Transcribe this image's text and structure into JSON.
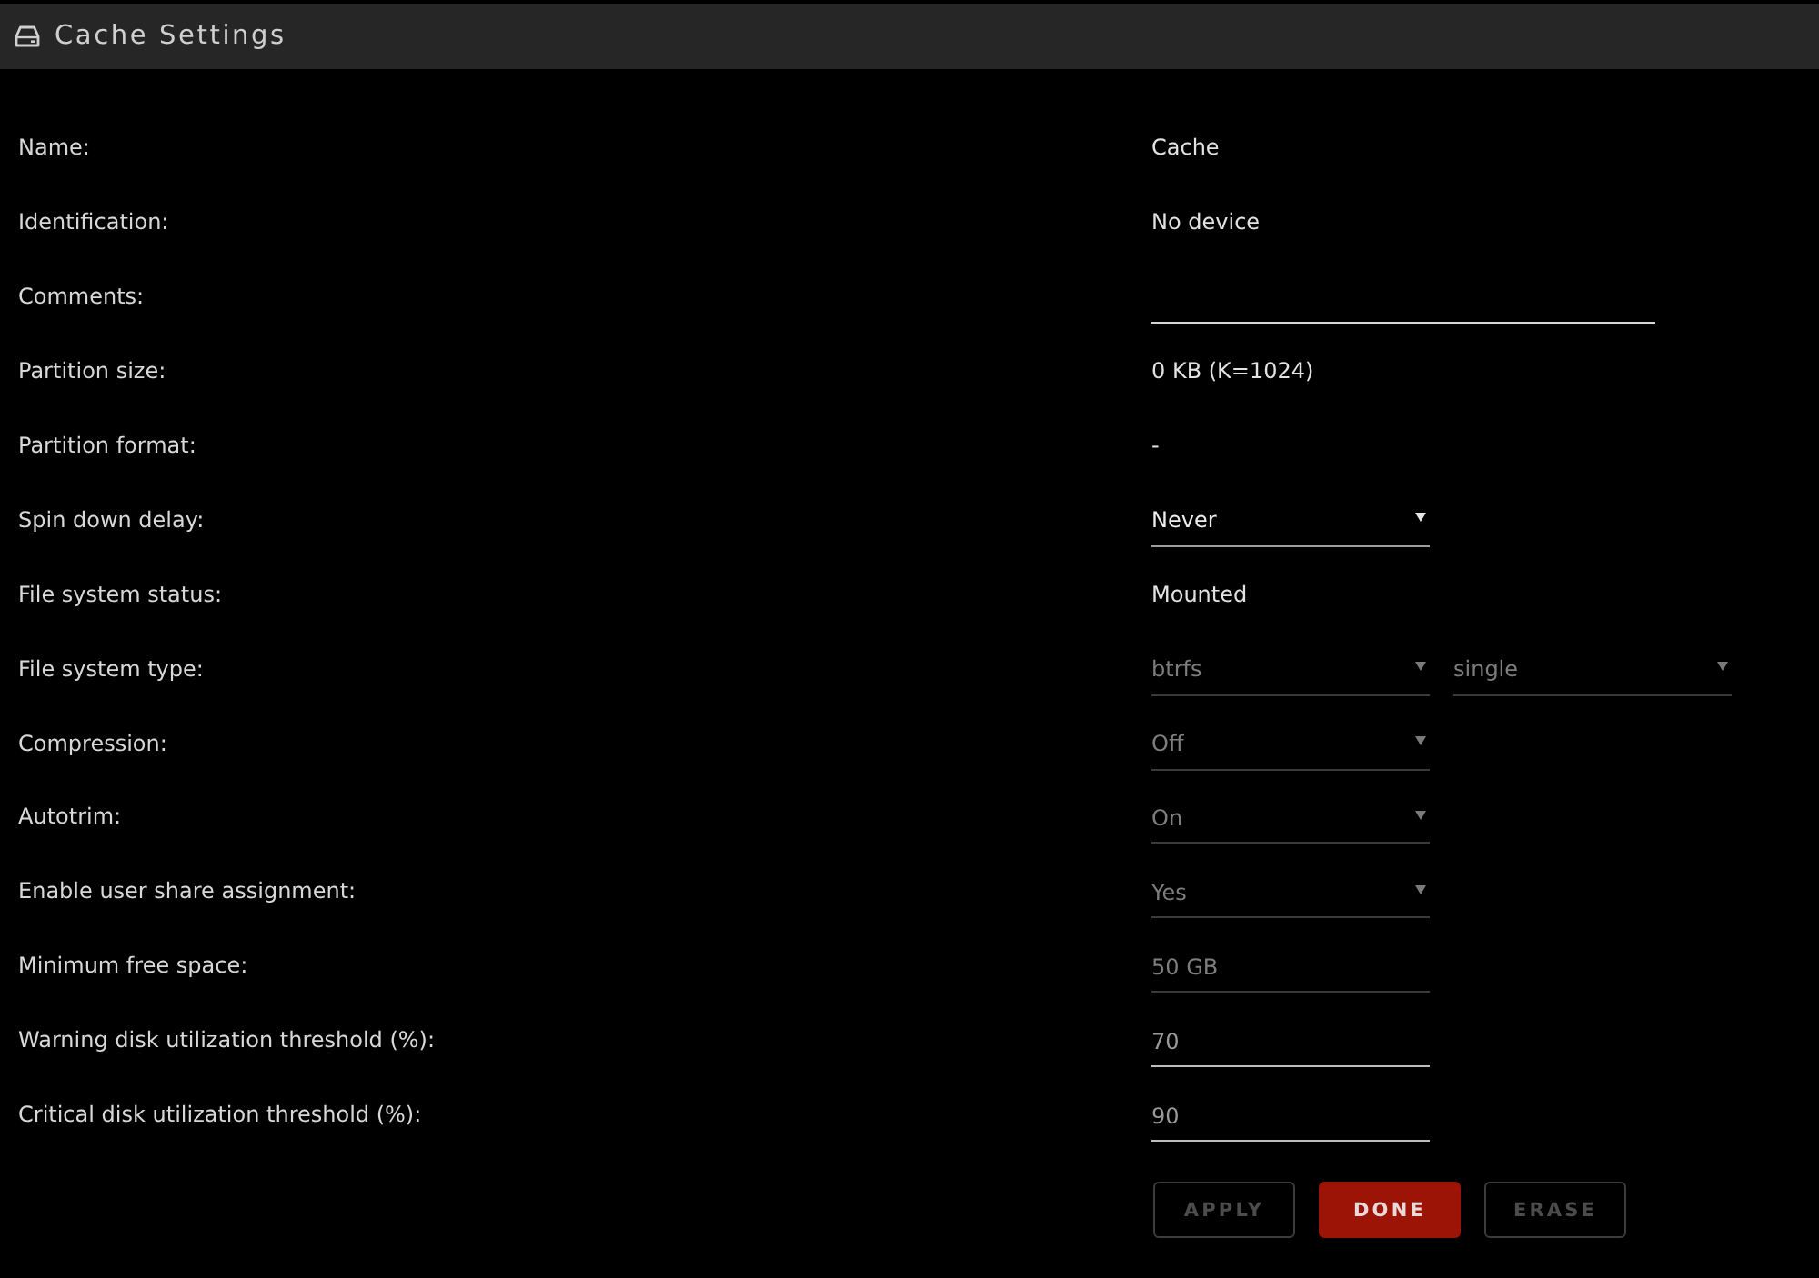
{
  "header": {
    "title": "Cache Settings"
  },
  "rows": [
    {
      "label": "Name:",
      "controls": [
        {
          "kind": "text",
          "value": "Cache"
        }
      ]
    },
    {
      "label": "Identification:",
      "controls": [
        {
          "kind": "text",
          "value": "No device"
        }
      ]
    },
    {
      "label": "Comments:",
      "controls": [
        {
          "kind": "wideinput",
          "disabled": false
        }
      ]
    },
    {
      "label": "Partition size:",
      "controls": [
        {
          "kind": "text",
          "value": "0 KB (K=1024)"
        }
      ]
    },
    {
      "label": "Partition format:",
      "controls": [
        {
          "kind": "text",
          "value": "-"
        }
      ]
    },
    {
      "label": "Spin down delay:",
      "controls": [
        {
          "kind": "select",
          "value": "Never",
          "disabled": false
        }
      ]
    },
    {
      "label": "File system status:",
      "controls": [
        {
          "kind": "text",
          "value": "Mounted"
        }
      ]
    },
    {
      "label": "File system type:",
      "controls": [
        {
          "kind": "select",
          "value": "btrfs",
          "disabled": true
        },
        {
          "kind": "select",
          "value": "single",
          "disabled": true
        }
      ]
    },
    {
      "label": "Compression:",
      "controls": [
        {
          "kind": "select",
          "value": "Off",
          "disabled": true
        }
      ]
    },
    {
      "label": "Autotrim:",
      "controls": [
        {
          "kind": "select",
          "value": "On",
          "disabled": true
        }
      ]
    },
    {
      "label": "Enable user share assignment:",
      "controls": [
        {
          "kind": "select",
          "value": "Yes",
          "disabled": true
        }
      ]
    },
    {
      "label": "Minimum free space:",
      "controls": [
        {
          "kind": "input",
          "value": "50 GB",
          "disabled": true
        }
      ]
    },
    {
      "label": "Warning disk utilization threshold (%):",
      "controls": [
        {
          "kind": "input",
          "placeholder": "70",
          "disabled": false
        }
      ]
    },
    {
      "label": "Critical disk utilization threshold (%):",
      "controls": [
        {
          "kind": "input",
          "placeholder": "90",
          "disabled": false
        }
      ]
    }
  ],
  "buttons": [
    {
      "label": "APPLY",
      "disabled": true
    },
    {
      "label": "DONE",
      "disabled": false
    },
    {
      "label": "ERASE",
      "disabled": true
    }
  ]
}
